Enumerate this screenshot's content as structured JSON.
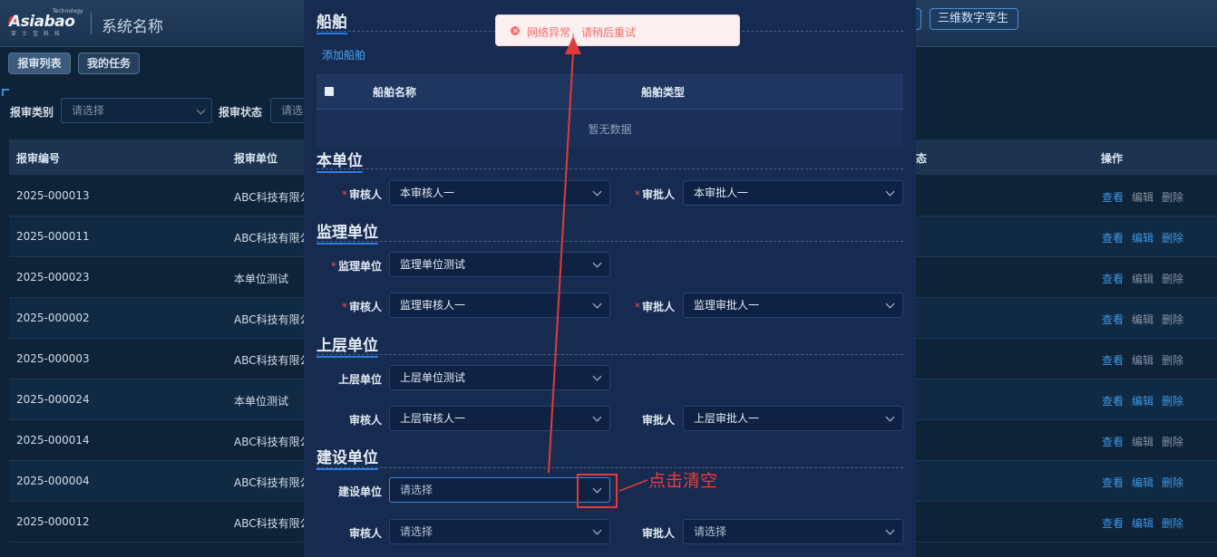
{
  "header": {
    "logo_text": "Asiabao",
    "logo_tech": "Technology",
    "logo_sub": "亚士宝科技",
    "system_title": "系统名称",
    "twin_button": "三维数字孪生"
  },
  "tabs": [
    {
      "label": "报审列表"
    },
    {
      "label": "我的任务"
    }
  ],
  "filters": {
    "type_label": "报审类别",
    "type_placeholder": "请选择",
    "status_label": "报审状态",
    "status_placeholder": "请选"
  },
  "table": {
    "headers": {
      "code": "报审编号",
      "unit": "报审单位",
      "status": "态",
      "ops": "操作"
    },
    "rows": [
      {
        "code": "2025-000013",
        "unit": "ABC科技有限公",
        "status": "",
        "edit_active": false
      },
      {
        "code": "2025-000011",
        "unit": "ABC科技有限公",
        "status": "",
        "edit_active": true
      },
      {
        "code": "2025-000023",
        "unit": "本单位测试",
        "status": "",
        "edit_active": false
      },
      {
        "code": "2025-000002",
        "unit": "ABC科技有限公",
        "status": "",
        "edit_active": false
      },
      {
        "code": "2025-000003",
        "unit": "ABC科技有限公",
        "status": "",
        "edit_active": false
      },
      {
        "code": "2025-000024",
        "unit": "本单位测试",
        "status": "",
        "edit_active": true
      },
      {
        "code": "2025-000014",
        "unit": "ABC科技有限公",
        "status": "",
        "edit_active": false
      },
      {
        "code": "2025-000004",
        "unit": "ABC科技有限公",
        "status": "",
        "edit_active": true
      },
      {
        "code": "2025-000012",
        "unit": "ABC科技有限公",
        "status": "",
        "edit_active": true
      }
    ],
    "actions": {
      "view": "查看",
      "edit": "编辑",
      "delete": "删除"
    }
  },
  "modal": {
    "ship_section": {
      "title": "船舶",
      "add_link": "添加船舶",
      "col_name": "船舶名称",
      "col_type": "船舶类型",
      "empty": "暂无数据"
    },
    "own_unit": {
      "title": "本单位",
      "reviewer_label": "审核人",
      "reviewer_value": "本审核人一",
      "approver_label": "审批人",
      "approver_value": "本审批人一"
    },
    "supervision": {
      "title": "监理单位",
      "unit_label": "监理单位",
      "unit_value": "监理单位测试",
      "reviewer_label": "审核人",
      "reviewer_value": "监理审核人一",
      "approver_label": "审批人",
      "approver_value": "监理审批人一"
    },
    "upper": {
      "title": "上层单位",
      "unit_label": "上层单位",
      "unit_value": "上层单位测试",
      "reviewer_label": "审核人",
      "reviewer_value": "上层审核人一",
      "approver_label": "审批人",
      "approver_value": "上层审批人一"
    },
    "construction": {
      "title": "建设单位",
      "unit_label": "建设单位",
      "unit_value": "请选择",
      "reviewer_label": "审核人",
      "reviewer_value": "请选择",
      "approver_label": "审批人",
      "approver_value": "请选择"
    }
  },
  "toast": {
    "message": "网络异常，请稍后重试",
    "color": "#f56c6c"
  },
  "annotation": {
    "text": "点击清空",
    "color": "#e23a3a"
  }
}
